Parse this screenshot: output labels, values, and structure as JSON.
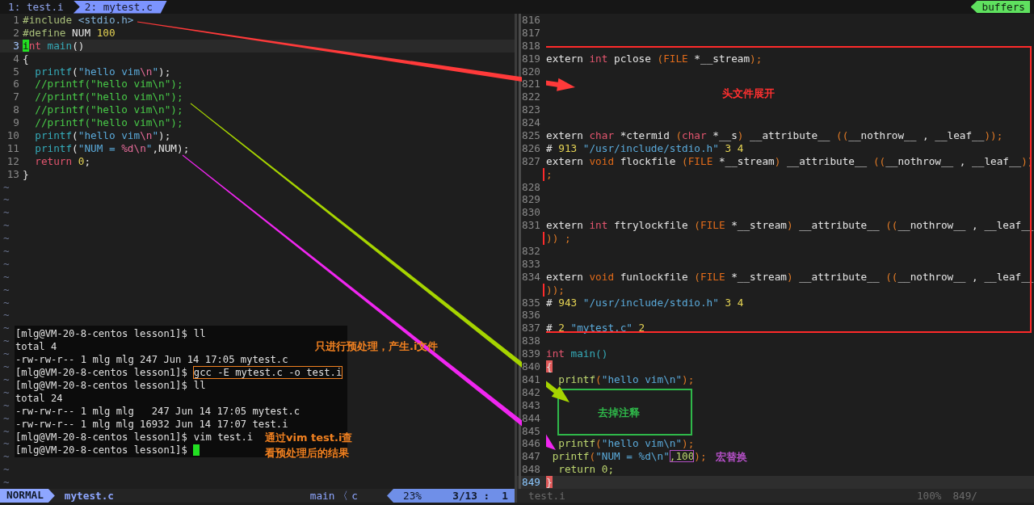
{
  "tabline": {
    "tabs": [
      {
        "label": "1: test.i",
        "selected": false
      },
      {
        "label": "2: mytest.c",
        "selected": true
      }
    ],
    "buffers_label": "buffers"
  },
  "left_pane": {
    "lines": [
      {
        "num": "1",
        "current": false,
        "tokens": [
          {
            "text": "#include ",
            "kind": "pre"
          },
          {
            "text": "<stdio.h>",
            "kind": "header"
          }
        ]
      },
      {
        "num": "2",
        "current": false,
        "tokens": [
          {
            "text": "#define",
            "kind": "pre"
          },
          {
            "text": " NUM ",
            "kind": "plain"
          },
          {
            "text": "100",
            "kind": "num"
          }
        ]
      },
      {
        "num": "3",
        "current": true,
        "tokens": [
          {
            "text": "i",
            "kind": "cursor"
          },
          {
            "text": "nt",
            "kind": "type"
          },
          {
            "text": " main",
            "kind": "func"
          },
          {
            "text": "()",
            "kind": "plain"
          }
        ]
      },
      {
        "num": "4",
        "current": false,
        "tokens": [
          {
            "text": "{",
            "kind": "plain"
          }
        ]
      },
      {
        "num": "5",
        "current": false,
        "tokens": [
          {
            "text": "  printf",
            "kind": "func"
          },
          {
            "text": "(",
            "kind": "plain"
          },
          {
            "text": "\"hello vim",
            "kind": "str"
          },
          {
            "text": "\\n",
            "kind": "esc"
          },
          {
            "text": "\"",
            "kind": "str"
          },
          {
            "text": ");",
            "kind": "plain"
          }
        ]
      },
      {
        "num": "6",
        "current": false,
        "tokens": [
          {
            "text": "  //printf(\"hello vim\\n\");",
            "kind": "comment"
          }
        ]
      },
      {
        "num": "7",
        "current": false,
        "tokens": [
          {
            "text": "  //printf(\"hello vim\\n\");",
            "kind": "comment"
          }
        ]
      },
      {
        "num": "8",
        "current": false,
        "tokens": [
          {
            "text": "  //printf(\"hello vim\\n\");",
            "kind": "comment"
          }
        ]
      },
      {
        "num": "9",
        "current": false,
        "tokens": [
          {
            "text": "  //printf(\"hello vim\\n\");",
            "kind": "comment"
          }
        ]
      },
      {
        "num": "10",
        "current": false,
        "tokens": [
          {
            "text": "  printf",
            "kind": "func"
          },
          {
            "text": "(",
            "kind": "plain"
          },
          {
            "text": "\"hello vim",
            "kind": "str"
          },
          {
            "text": "\\n",
            "kind": "esc"
          },
          {
            "text": "\"",
            "kind": "str"
          },
          {
            "text": ");",
            "kind": "plain"
          }
        ]
      },
      {
        "num": "11",
        "current": false,
        "tokens": [
          {
            "text": "  printf",
            "kind": "func"
          },
          {
            "text": "(",
            "kind": "plain"
          },
          {
            "text": "\"NUM = ",
            "kind": "str"
          },
          {
            "text": "%d\\n",
            "kind": "esc"
          },
          {
            "text": "\"",
            "kind": "str"
          },
          {
            "text": ",NUM);",
            "kind": "plain"
          }
        ]
      },
      {
        "num": "12",
        "current": false,
        "tokens": [
          {
            "text": "  return",
            "kind": "kw"
          },
          {
            "text": " 0",
            "kind": "num"
          },
          {
            "text": ";",
            "kind": "plain"
          }
        ]
      },
      {
        "num": "13",
        "current": false,
        "tokens": [
          {
            "text": "}",
            "kind": "plain"
          }
        ]
      }
    ],
    "empty_lines": [
      "~",
      "~",
      "~",
      "~",
      "~",
      "~",
      "~",
      "~",
      "~",
      "~",
      "~",
      "~",
      "~",
      "~",
      "~",
      "~",
      "~",
      "~",
      "~",
      "~",
      "~",
      "~",
      "~",
      "~"
    ]
  },
  "right_pane": {
    "lines": [
      {
        "num": "816",
        "current": false
      },
      {
        "num": "817",
        "current": false
      },
      {
        "num": "818",
        "current": false
      },
      {
        "num": "819",
        "current": false,
        "tokens": [
          {
            "text": "extern ",
            "kind": "plain"
          },
          {
            "text": "int",
            "kind": "type"
          },
          {
            "text": " pclose ",
            "kind": "plain"
          },
          {
            "text": "(",
            "kind": "paren"
          },
          {
            "text": "FILE",
            "kind": "storage"
          },
          {
            "text": " *__stream",
            "kind": "plain"
          },
          {
            "text": ");",
            "kind": "paren"
          }
        ]
      },
      {
        "num": "820",
        "current": false
      },
      {
        "num": "821",
        "current": false
      },
      {
        "num": "822",
        "current": false
      },
      {
        "num": "823",
        "current": false
      },
      {
        "num": "824",
        "current": false
      },
      {
        "num": "825",
        "current": false,
        "tokens": [
          {
            "text": "extern ",
            "kind": "plain"
          },
          {
            "text": "char",
            "kind": "type"
          },
          {
            "text": " *ctermid ",
            "kind": "plain"
          },
          {
            "text": "(",
            "kind": "paren"
          },
          {
            "text": "char",
            "kind": "type"
          },
          {
            "text": " *__s",
            "kind": "plain"
          },
          {
            "text": ")",
            "kind": "paren"
          },
          {
            "text": " __attribute__ ",
            "kind": "plain"
          },
          {
            "text": "((",
            "kind": "paren"
          },
          {
            "text": "__nothrow__ , __leaf__",
            "kind": "plain"
          },
          {
            "text": "));",
            "kind": "paren"
          }
        ]
      },
      {
        "num": "826",
        "current": false,
        "tokens": [
          {
            "text": "# ",
            "kind": "plain"
          },
          {
            "text": "913 ",
            "kind": "num"
          },
          {
            "text": "\"/usr/include/stdio.h\"",
            "kind": "str"
          },
          {
            "text": " 3 4",
            "kind": "num"
          }
        ]
      },
      {
        "num": "827",
        "current": false,
        "tokens": [
          {
            "text": "extern ",
            "kind": "plain"
          },
          {
            "text": "void",
            "kind": "storage"
          },
          {
            "text": " flockfile ",
            "kind": "plain"
          },
          {
            "text": "(",
            "kind": "paren"
          },
          {
            "text": "FILE",
            "kind": "storage"
          },
          {
            "text": " *__stream",
            "kind": "plain"
          },
          {
            "text": ")",
            "kind": "paren"
          },
          {
            "text": " __attribute__ ",
            "kind": "plain"
          },
          {
            "text": "((",
            "kind": "paren"
          },
          {
            "text": "__nothrow__ , __leaf__",
            "kind": "plain"
          },
          {
            "text": "))",
            "kind": "paren"
          }
        ]
      },
      {
        "current": false,
        "tokens": [
          {
            "text": ";",
            "kind": "paren"
          }
        ]
      },
      {
        "num": "828",
        "current": false
      },
      {
        "num": "829",
        "current": false
      },
      {
        "num": "830",
        "current": false
      },
      {
        "num": "831",
        "current": false,
        "tokens": [
          {
            "text": "extern ",
            "kind": "plain"
          },
          {
            "text": "int",
            "kind": "type"
          },
          {
            "text": " ftrylockfile ",
            "kind": "plain"
          },
          {
            "text": "(",
            "kind": "paren"
          },
          {
            "text": "FILE",
            "kind": "storage"
          },
          {
            "text": " *__stream",
            "kind": "plain"
          },
          {
            "text": ")",
            "kind": "paren"
          },
          {
            "text": " __attribute__ ",
            "kind": "plain"
          },
          {
            "text": "((",
            "kind": "paren"
          },
          {
            "text": "__nothrow__ , __leaf__",
            "kind": "plain"
          }
        ]
      },
      {
        "current": false,
        "tokens": [
          {
            "text": ")) ;",
            "kind": "paren"
          }
        ]
      },
      {
        "num": "832",
        "current": false
      },
      {
        "num": "833",
        "current": false
      },
      {
        "num": "834",
        "current": false,
        "tokens": [
          {
            "text": "extern ",
            "kind": "plain"
          },
          {
            "text": "void",
            "kind": "storage"
          },
          {
            "text": " funlockfile ",
            "kind": "plain"
          },
          {
            "text": "(",
            "kind": "paren"
          },
          {
            "text": "FILE",
            "kind": "storage"
          },
          {
            "text": " *__stream",
            "kind": "plain"
          },
          {
            "text": ")",
            "kind": "paren"
          },
          {
            "text": " __attribute__ ",
            "kind": "plain"
          },
          {
            "text": "((",
            "kind": "paren"
          },
          {
            "text": "__nothrow__ , __leaf__",
            "kind": "plain"
          }
        ]
      },
      {
        "current": false,
        "tokens": [
          {
            "text": "));",
            "kind": "paren"
          }
        ]
      },
      {
        "num": "835",
        "current": false,
        "tokens": [
          {
            "text": "# ",
            "kind": "plain"
          },
          {
            "text": "943 ",
            "kind": "num"
          },
          {
            "text": "\"/usr/include/stdio.h\"",
            "kind": "str"
          },
          {
            "text": " 3 4",
            "kind": "num"
          }
        ]
      },
      {
        "num": "836",
        "current": false
      },
      {
        "num": "837",
        "current": false,
        "tokens": [
          {
            "text": "# ",
            "kind": "plain"
          },
          {
            "text": "2 ",
            "kind": "num"
          },
          {
            "text": "\"mytest.c\"",
            "kind": "str"
          },
          {
            "text": " 2",
            "kind": "num"
          }
        ]
      },
      {
        "num": "838",
        "current": false
      },
      {
        "num": "839",
        "current": false,
        "tokens": [
          {
            "text": "int",
            "kind": "type"
          },
          {
            "text": " main()",
            "kind": "func"
          }
        ]
      },
      {
        "num": "840",
        "current": false,
        "tokens": [
          {
            "text": "{",
            "kind": "match"
          }
        ]
      },
      {
        "num": "841",
        "current": false,
        "tokens": [
          {
            "text": "  printf",
            "kind": "call"
          },
          {
            "text": "(",
            "kind": "paren"
          },
          {
            "text": "\"hello vim\\n\"",
            "kind": "str"
          },
          {
            "text": ");",
            "kind": "paren"
          }
        ]
      },
      {
        "num": "842",
        "current": false
      },
      {
        "num": "843",
        "current": false
      },
      {
        "num": "844",
        "current": false
      },
      {
        "num": "845",
        "current": false
      },
      {
        "num": "846",
        "current": false,
        "tokens": [
          {
            "text": "  printf",
            "kind": "call"
          },
          {
            "text": "(",
            "kind": "paren"
          },
          {
            "text": "\"hello vim\\n\"",
            "kind": "str"
          },
          {
            "text": ");",
            "kind": "paren"
          }
        ]
      },
      {
        "num": "847",
        "current": false,
        "tokens": [
          {
            "text": " printf",
            "kind": "call"
          },
          {
            "text": "(",
            "kind": "paren"
          },
          {
            "text": "\"NUM = %d\\n\"",
            "kind": "str"
          },
          {
            "text": ",100",
            "kind": "boxed"
          },
          {
            "text": ");",
            "kind": "paren"
          }
        ]
      },
      {
        "num": "848",
        "current": false,
        "tokens": [
          {
            "text": "  return 0;",
            "kind": "call"
          }
        ]
      },
      {
        "num": "849",
        "current": true,
        "tokens": [
          {
            "text": "}",
            "kind": "match"
          }
        ]
      }
    ]
  },
  "terminal": {
    "cursor": true,
    "lines": [
      {
        "kind": "prompt",
        "prompt": "[mlg@VM-20-8-centos lesson1]$",
        "command": "ll"
      },
      {
        "kind": "output",
        "text": "total 4"
      },
      {
        "kind": "output",
        "text": "-rw-rw-r-- 1 mlg mlg 247 Jun 14 17:05 mytest.c"
      },
      {
        "kind": "framed_prompt",
        "prompt": "[mlg@VM-20-8-centos lesson1]$",
        "command": "gcc -E mytest.c -o test.i"
      },
      {
        "kind": "prompt",
        "prompt": "[mlg@VM-20-8-centos lesson1]$",
        "command": "ll"
      },
      {
        "kind": "output",
        "text": "total 24"
      },
      {
        "kind": "output",
        "text": "-rw-rw-r-- 1 mlg mlg   247 Jun 14 17:05 mytest.c"
      },
      {
        "kind": "output",
        "text": "-rw-rw-r-- 1 mlg mlg 16932 Jun 14 17:07 test.i"
      },
      {
        "kind": "prompt",
        "prompt": "[mlg@VM-20-8-centos lesson1]$",
        "command": "vim test.i"
      },
      {
        "kind": "prompt",
        "prompt": "[mlg@VM-20-8-centos lesson1]$"
      }
    ]
  },
  "status_left": {
    "mode": "NORMAL",
    "file": "mytest.c",
    "function": "main",
    "separator": "〈",
    "filetype": "c",
    "percent": "23%",
    "position": "3/13 :  1"
  },
  "status_right": {
    "file": "test.i",
    "percent": "100%",
    "position": "849/"
  },
  "annotations": [
    {
      "lines": [
        "头文件展开"
      ],
      "color": "#ff3030"
    },
    {
      "lines": [
        "去掉注释"
      ],
      "color": "#2fb84a"
    },
    {
      "lines": [
        "宏替换"
      ],
      "color": "#b24fc4"
    },
    {
      "lines": [
        "只进行预处理，产生.i文件"
      ],
      "color": "#f08020"
    },
    {
      "lines": [
        "通过vim test.i查",
        "看预处理后的结果"
      ],
      "color": "#f08020"
    }
  ]
}
